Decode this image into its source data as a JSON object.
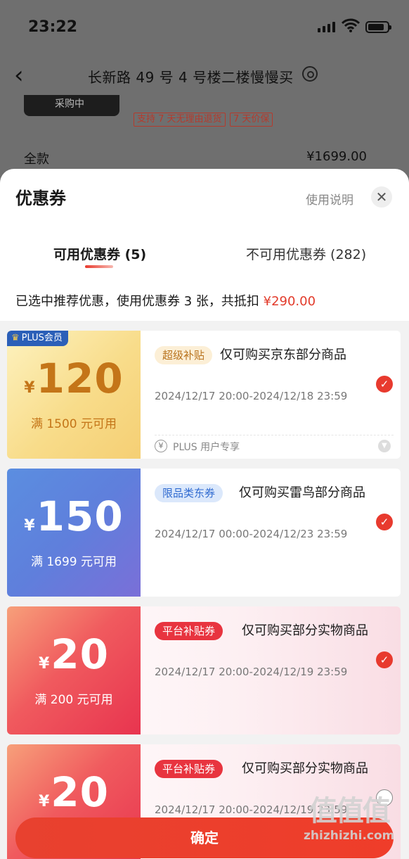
{
  "status_bar": {
    "time": "23:22"
  },
  "nav": {
    "back": "‹",
    "title": "长新路 49 号 4 号楼二楼慢慢买"
  },
  "background": {
    "thumb_text": "采购中",
    "tags": [
      "支持 7 天无理由退货",
      "7 天价保"
    ],
    "full_label": "全款",
    "full_price": "¥1699.00"
  },
  "sheet": {
    "title": "优惠券",
    "usage_link": "使用说明",
    "close": "✕",
    "tabs": [
      {
        "label": "可用优惠券 (5)",
        "active": true
      },
      {
        "label": "不可用优惠券 (282)",
        "active": false
      }
    ],
    "summary_prefix": "已选中推荐优惠，使用优惠券 3 张，共抵扣 ",
    "summary_amount": "¥290.00"
  },
  "coupons": [
    {
      "plus_badge": "PLUS会员",
      "currency": "¥",
      "amount": "120",
      "condition": "满 1500 元可用",
      "badge": "超级补贴",
      "title": "仅可购买京东部分商品",
      "validity": "2024/12/17 20:00-2024/12/18 23:59",
      "selected": true,
      "plus_note": "PLUS 用户专享"
    },
    {
      "currency": "¥",
      "amount": "150",
      "condition": "满 1699 元可用",
      "badge": "限品类东券",
      "title": "仅可购买雷鸟部分商品",
      "validity": "2024/12/17 00:00-2024/12/23 23:59",
      "selected": true
    },
    {
      "currency": "¥",
      "amount": "20",
      "condition": "满 200 元可用",
      "badge": "平台补贴券",
      "title": "仅可购买部分实物商品",
      "validity": "2024/12/17 20:00-2024/12/19 23:59",
      "selected": true
    },
    {
      "currency": "¥",
      "amount": "20",
      "badge": "平台补贴券",
      "title": "仅可购买部分实物商品",
      "validity": "2024/12/17 20:00-2024/12/19 23:59",
      "selected": false
    }
  ],
  "confirm_button": "确定",
  "watermark": {
    "logo": "值值值",
    "site": "zhizhizhi.com"
  },
  "colors": {
    "accent": "#e83a2e",
    "plus_blue": "#2b5fb8",
    "gold": "#c87a1c"
  }
}
